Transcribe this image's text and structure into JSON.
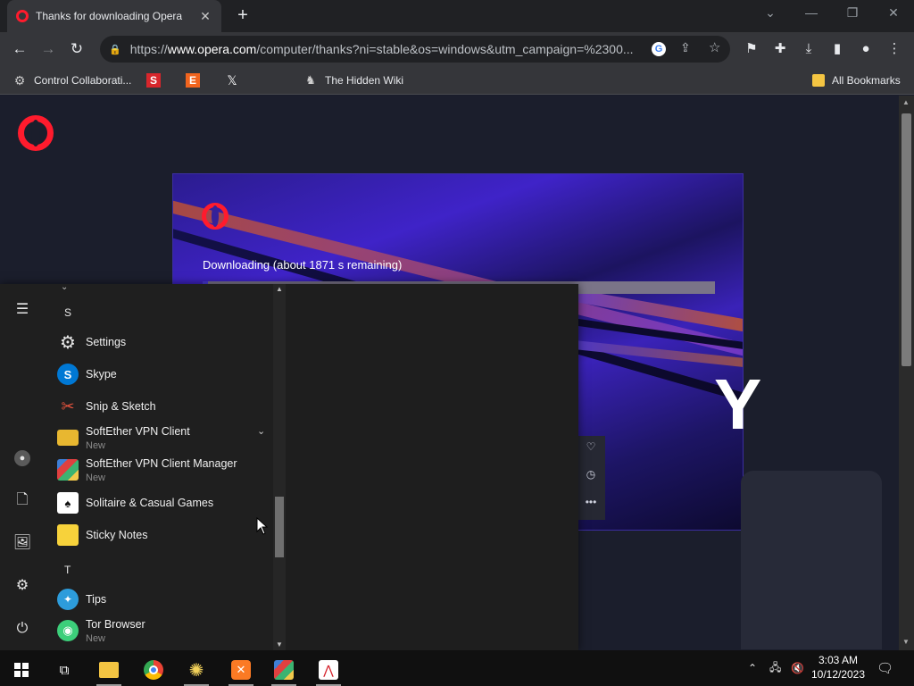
{
  "browser": {
    "tab_title": "Thanks for downloading Opera",
    "tab_close": "✕",
    "new_tab": "+",
    "url_prefix": "https://",
    "url_host": "www.opera.com",
    "url_rest": "/computer/thanks?ni=stable&os=windows&utm_campaign=%2300...",
    "bookmarks": [
      {
        "label": "Control Collaborati...",
        "icon": "control-collaboration-icon"
      },
      {
        "label": "",
        "icon": "s-bookmark-icon"
      },
      {
        "label": "",
        "icon": "e-bookmark-icon"
      },
      {
        "label": "",
        "icon": "x-bookmark-icon"
      },
      {
        "label": "The Hidden Wiki",
        "icon": "hidden-wiki-icon"
      }
    ],
    "all_bookmarks": "All Bookmarks"
  },
  "page": {
    "download_text": "Downloading (about 1871 s remaining)",
    "download_progress": 0.01,
    "big_letter": "Y"
  },
  "start_menu": {
    "letters": {
      "s": "S",
      "t": "T"
    },
    "apps": [
      {
        "name": "Settings",
        "sub": "",
        "icon": "gear-icon",
        "color": "#1f1f1f",
        "glyph": "⚙"
      },
      {
        "name": "Skype",
        "sub": "",
        "icon": "skype-icon",
        "color": "#0078d4",
        "glyph": "S"
      },
      {
        "name": "Snip & Sketch",
        "sub": "",
        "icon": "snip-sketch-icon",
        "color": "#1f1f1f",
        "glyph": "✂"
      },
      {
        "name": "SoftEther VPN Client",
        "sub": "New",
        "icon": "folder-icon",
        "color": "#e8b730",
        "glyph": ""
      },
      {
        "name": "SoftEther VPN Client Manager",
        "sub": "New",
        "icon": "softether-manager-icon",
        "color": "#3a3a3a",
        "glyph": "▦"
      },
      {
        "name": "Solitaire & Casual Games",
        "sub": "",
        "icon": "solitaire-icon",
        "color": "#3a3a3a",
        "glyph": "♠"
      },
      {
        "name": "Sticky Notes",
        "sub": "",
        "icon": "sticky-notes-icon",
        "color": "#f7d23b",
        "glyph": ""
      },
      {
        "name": "Tips",
        "sub": "",
        "icon": "tips-icon",
        "color": "#2d9cdb",
        "glyph": "💡"
      },
      {
        "name": "Tor Browser",
        "sub": "New",
        "icon": "tor-browser-icon",
        "color": "#3ccf7a",
        "glyph": "◉"
      }
    ]
  },
  "taskbar": {
    "time": "3:03 AM",
    "date": "10/12/2023"
  }
}
